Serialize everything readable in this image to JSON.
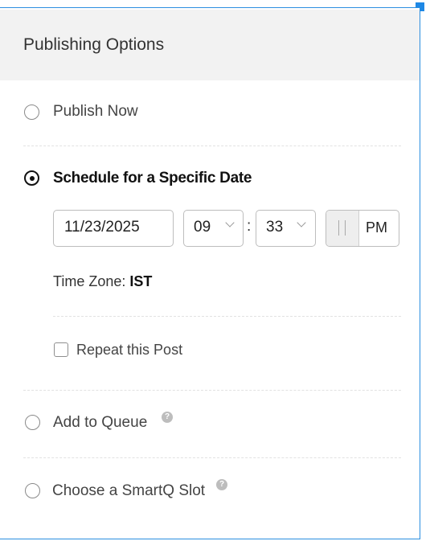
{
  "header": {
    "title": "Publishing Options"
  },
  "options": {
    "publish_now": "Publish Now",
    "schedule": "Schedule for a Specific Date",
    "add_to_queue": "Add to Queue",
    "smartq": "Choose a SmartQ Slot"
  },
  "selected_option": "schedule",
  "schedule": {
    "date": "11/23/2025",
    "hour": "09",
    "separator": ":",
    "minute": "33",
    "meridiem": "PM",
    "timezone_label": "Time Zone: ",
    "timezone_value": "IST",
    "repeat_label": "Repeat this Post",
    "repeat_checked": false
  },
  "icons": {
    "help": "question-mark-circle",
    "dropdown": "chevron-down",
    "toggle": "double-bar"
  },
  "colors": {
    "accent_border": "#2a8ee0",
    "handle": "#1e88e5",
    "header_bg": "#f2f2f2"
  }
}
